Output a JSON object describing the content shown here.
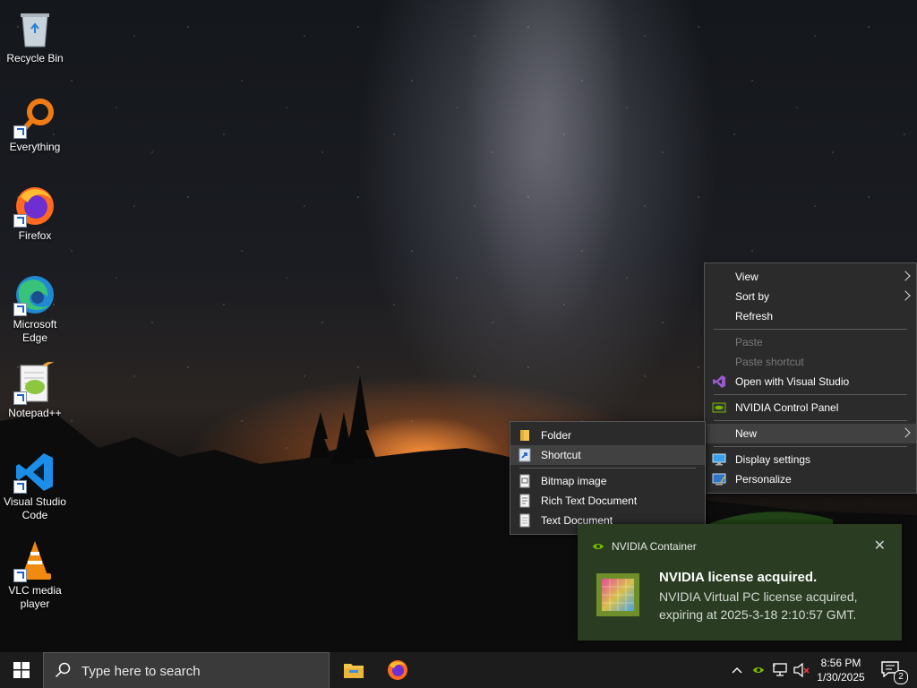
{
  "desktop": {
    "icons": [
      {
        "label": "Recycle Bin",
        "icon": "recycle-bin-icon"
      },
      {
        "label": "Everything",
        "icon": "everything-icon"
      },
      {
        "label": "Firefox",
        "icon": "firefox-icon"
      },
      {
        "label": "Microsoft Edge",
        "icon": "edge-icon"
      },
      {
        "label": "Notepad++",
        "icon": "notepadpp-icon"
      },
      {
        "label": "Visual Studio Code",
        "icon": "vscode-icon"
      },
      {
        "label": "VLC media player",
        "icon": "vlc-icon"
      }
    ]
  },
  "context_menu": {
    "items": {
      "view": "View",
      "sort_by": "Sort by",
      "refresh": "Refresh",
      "paste": "Paste",
      "paste_shortcut": "Paste shortcut",
      "open_vs": "Open with Visual Studio",
      "nvidia": "NVIDIA Control Panel",
      "new": "New",
      "display": "Display settings",
      "personalize": "Personalize"
    }
  },
  "new_submenu": {
    "items": {
      "folder": "Folder",
      "shortcut": "Shortcut",
      "bitmap": "Bitmap image",
      "rtf": "Rich Text Document",
      "text": "Text Document"
    }
  },
  "notification": {
    "app": "NVIDIA Container",
    "title": "NVIDIA license acquired.",
    "body": "NVIDIA Virtual PC license acquired, expiring at 2025-3-18 2:10:57 GMT.",
    "close": "✕"
  },
  "taskbar": {
    "search_placeholder": "Type here to search",
    "apps": [
      "file-explorer-icon",
      "firefox-icon"
    ],
    "clock": {
      "time": "8:56 PM",
      "date": "1/30/2025"
    },
    "notifications_count": "2"
  },
  "colors": {
    "menu_bg": "#2b2b2b",
    "menu_hover": "#414141",
    "toast_bg": "#2a3d23",
    "taskbar_bg": "#1c1c1c",
    "nvidia_green": "#76b900"
  }
}
